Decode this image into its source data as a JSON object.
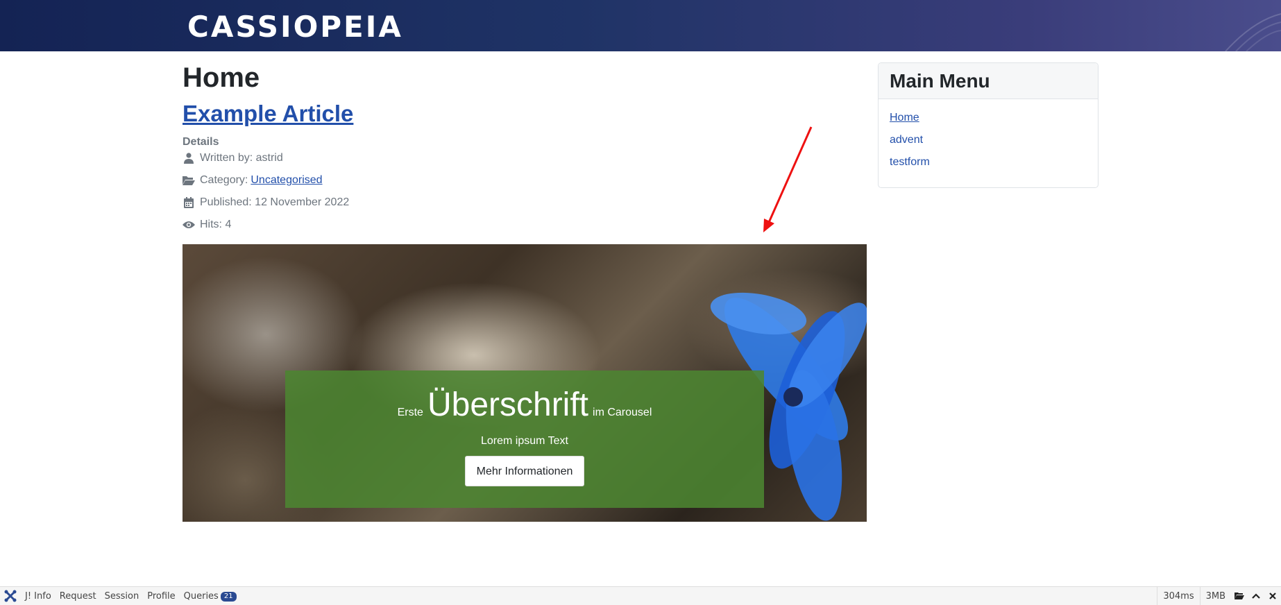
{
  "header": {
    "brand": "CASSIOPEIA"
  },
  "main": {
    "page_title": "Home",
    "article_title": "Example Article",
    "details_heading": "Details",
    "meta": {
      "written_by": "Written by: astrid",
      "category_label": "Category:",
      "category_link": "Uncategorised",
      "published": "Published: 12 November 2022",
      "hits": "Hits: 4"
    }
  },
  "carousel": {
    "headline_pre": "Erste",
    "headline_main": "Überschrift",
    "headline_post": "im Carousel",
    "lead": "Lorem ipsum Text",
    "button_label": "Mehr Informationen",
    "caption_color": "#4c8531"
  },
  "sidebar": {
    "title": "Main Menu",
    "items": [
      {
        "label": "Home",
        "current": true
      },
      {
        "label": "advent",
        "current": false
      },
      {
        "label": "testform",
        "current": false
      }
    ]
  },
  "debugbar": {
    "tabs": [
      "J! Info",
      "Request",
      "Session",
      "Profile",
      "Queries"
    ],
    "queries_count": "21",
    "time": "304ms",
    "memory": "3MB",
    "icons": [
      "folder-open-icon",
      "chevron-up-icon",
      "close-icon"
    ]
  },
  "colors": {
    "link": "#224faa",
    "header_start": "#142354",
    "header_end": "#4a4d8c",
    "annotation_arrow": "#ee1111"
  }
}
